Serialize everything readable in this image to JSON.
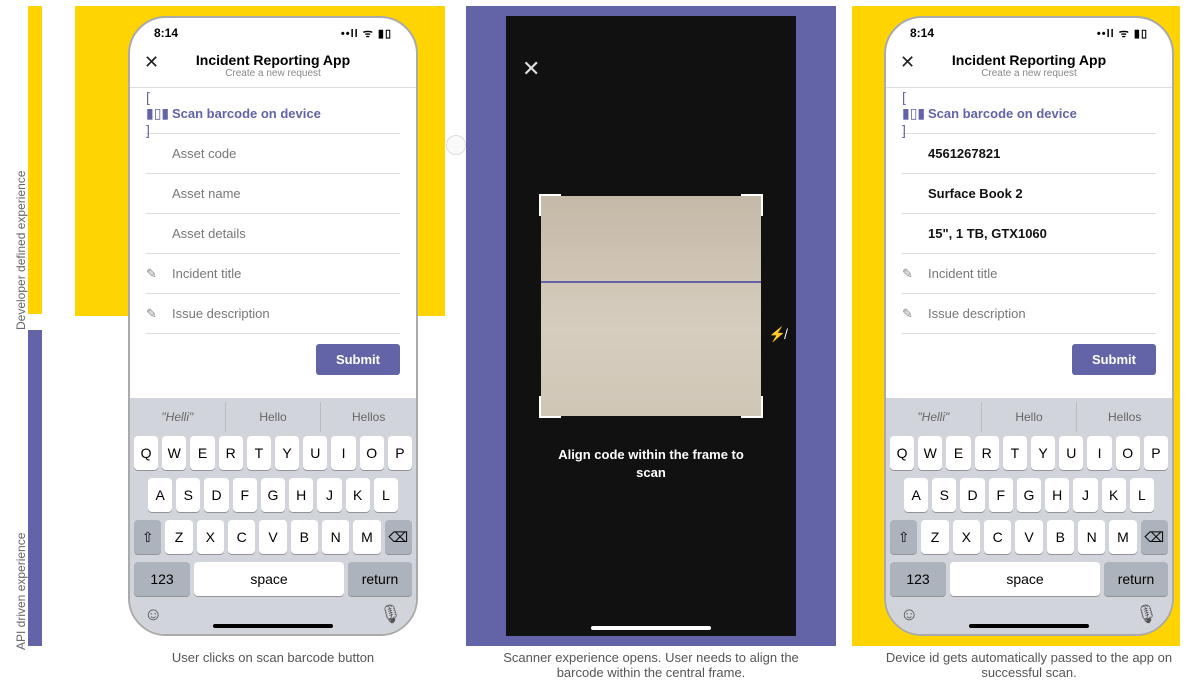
{
  "labels": {
    "vtop": "Developer defined experience",
    "vbottom": "API driven experience"
  },
  "status": {
    "time": "8:14",
    "icons": "••ll ᯤ ▮▯"
  },
  "app": {
    "title": "Incident Reporting App",
    "subtitle": "Create a new request"
  },
  "rows": {
    "scan": "Scan barcode on device",
    "code_ph": "Asset code",
    "name_ph": "Asset name",
    "details_ph": "Asset details",
    "code_val": "4561267821",
    "name_val": "Surface Book 2",
    "details_val": "15\", 1 TB, GTX1060",
    "incident": "Incident title",
    "issue": "Issue description"
  },
  "submit": "Submit",
  "sugg": {
    "a": "\"Helli\"",
    "b": "Hello",
    "c": "Hellos"
  },
  "kb": {
    "r1": [
      "Q",
      "W",
      "E",
      "R",
      "T",
      "Y",
      "U",
      "I",
      "O",
      "P"
    ],
    "r2": [
      "A",
      "S",
      "D",
      "F",
      "G",
      "H",
      "J",
      "K",
      "L"
    ],
    "r3": [
      "⇧",
      "Z",
      "X",
      "C",
      "V",
      "B",
      "N",
      "M",
      "⌫"
    ],
    "num": "123",
    "space": "space",
    "ret": "return"
  },
  "scanner": {
    "align": "Align code within the frame to scan"
  },
  "captions": {
    "c1": "User clicks on scan barcode button",
    "c2": "Scanner experience opens. User needs to align the barcode within the central frame.",
    "c3": "Device id gets automatically passed to the app on successful scan."
  }
}
